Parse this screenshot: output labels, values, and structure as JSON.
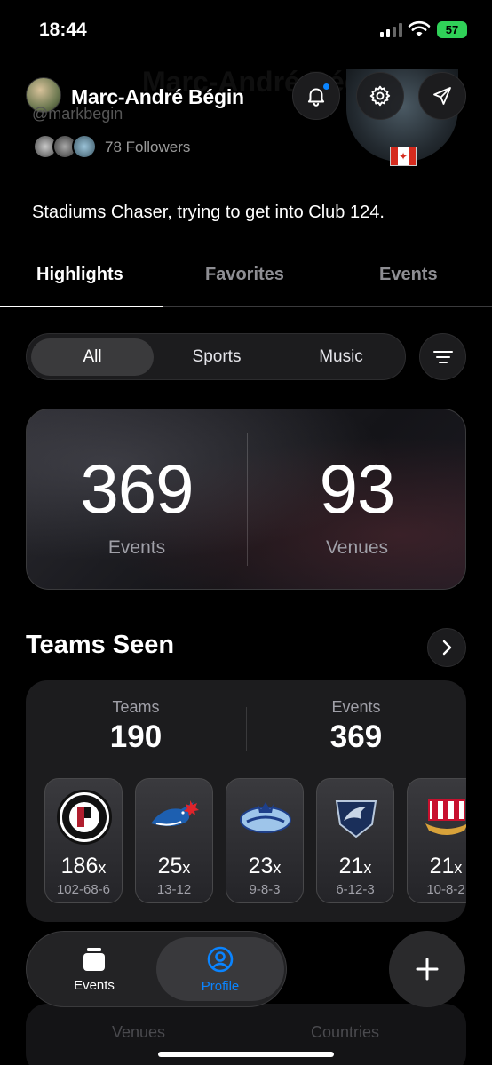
{
  "status_bar": {
    "time": "18:44",
    "battery": "57"
  },
  "profile": {
    "name": "Marc-André Bégin",
    "handle": "@markbegin",
    "followers": "78 Followers",
    "bio": "Stadiums Chaser, trying to get into Club 124.",
    "flag_icon": "canada-flag-icon"
  },
  "header_buttons": [
    {
      "icon": "bell-icon"
    },
    {
      "icon": "gear-icon"
    },
    {
      "icon": "send-icon"
    }
  ],
  "tabs": [
    {
      "label": "Highlights",
      "active": true
    },
    {
      "label": "Favorites",
      "active": false
    },
    {
      "label": "Events",
      "active": false
    }
  ],
  "filters": {
    "options": [
      "All",
      "Sports",
      "Music"
    ],
    "selected": "All"
  },
  "stats": {
    "events": {
      "value": "369",
      "label": "Events"
    },
    "venues": {
      "value": "93",
      "label": "Venues"
    }
  },
  "teams_seen": {
    "title": "Teams Seen",
    "teams_label": "Teams",
    "teams_value": "190",
    "events_label": "Events",
    "events_value": "369",
    "tiles": [
      {
        "team": "Remparts de Québec",
        "count": "186",
        "suffix": "x",
        "record": "102-68-6"
      },
      {
        "team": "Toronto Blue Jays",
        "count": "25",
        "suffix": "x",
        "record": "13-12"
      },
      {
        "team": "Saguenéens",
        "count": "23",
        "suffix": "x",
        "record": "9-8-3"
      },
      {
        "team": "Rimouski Océanic",
        "count": "21",
        "suffix": "x",
        "record": "6-12-3"
      },
      {
        "team": "Drakkar",
        "count": "21",
        "suffix": "x",
        "record": "10-8-2"
      }
    ]
  },
  "below": {
    "venues_label": "Venues",
    "countries_label": "Countries"
  },
  "bottom_nav": {
    "events_label": "Events",
    "profile_label": "Profile",
    "accent": "#0a84ff"
  }
}
